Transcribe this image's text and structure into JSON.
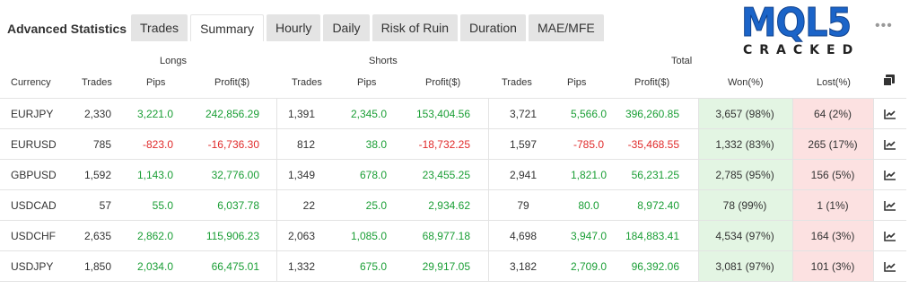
{
  "app": {
    "title": "Advanced Statistics"
  },
  "tabs": [
    {
      "label": "Trades",
      "active": false
    },
    {
      "label": "Summary",
      "active": true
    },
    {
      "label": "Hourly",
      "active": false
    },
    {
      "label": "Daily",
      "active": false
    },
    {
      "label": "Risk of Ruin",
      "active": false
    },
    {
      "label": "Duration",
      "active": false
    },
    {
      "label": "MAE/MFE",
      "active": false
    }
  ],
  "logo": {
    "main": "MQL5",
    "sub": "CRACKED"
  },
  "more_icon": "more-horizontal-icon",
  "groups": {
    "longs": "Longs",
    "shorts": "Shorts",
    "total": "Total"
  },
  "columns": {
    "currency": "Currency",
    "long_trades": "Trades",
    "long_pips": "Pips",
    "long_profit": "Profit($)",
    "short_trades": "Trades",
    "short_pips": "Pips",
    "short_profit": "Profit($)",
    "total_trades": "Trades",
    "total_pips": "Pips",
    "total_profit": "Profit($)",
    "won": "Won(%)",
    "lost": "Lost(%)"
  },
  "colors": {
    "positive": "#1a9e35",
    "negative": "#e02b2b",
    "won_bg": "#e3f5e3",
    "lost_bg": "#fce1e1"
  },
  "rows": [
    {
      "currency": "EURJPY",
      "long_trades": "2,330",
      "long_pips": "3,221.0",
      "long_profit": "242,856.29",
      "short_trades": "1,391",
      "short_pips": "2,345.0",
      "short_profit": "153,404.56",
      "total_trades": "3,721",
      "total_pips": "5,566.0",
      "total_profit": "396,260.85",
      "won": "3,657 (98%)",
      "lost": "64 (2%)"
    },
    {
      "currency": "EURUSD",
      "long_trades": "785",
      "long_pips": "-823.0",
      "long_profit": "-16,736.30",
      "short_trades": "812",
      "short_pips": "38.0",
      "short_profit": "-18,732.25",
      "total_trades": "1,597",
      "total_pips": "-785.0",
      "total_profit": "-35,468.55",
      "won": "1,332 (83%)",
      "lost": "265 (17%)"
    },
    {
      "currency": "GBPUSD",
      "long_trades": "1,592",
      "long_pips": "1,143.0",
      "long_profit": "32,776.00",
      "short_trades": "1,349",
      "short_pips": "678.0",
      "short_profit": "23,455.25",
      "total_trades": "2,941",
      "total_pips": "1,821.0",
      "total_profit": "56,231.25",
      "won": "2,785 (95%)",
      "lost": "156 (5%)"
    },
    {
      "currency": "USDCAD",
      "long_trades": "57",
      "long_pips": "55.0",
      "long_profit": "6,037.78",
      "short_trades": "22",
      "short_pips": "25.0",
      "short_profit": "2,934.62",
      "total_trades": "79",
      "total_pips": "80.0",
      "total_profit": "8,972.40",
      "won": "78 (99%)",
      "lost": "1 (1%)"
    },
    {
      "currency": "USDCHF",
      "long_trades": "2,635",
      "long_pips": "2,862.0",
      "long_profit": "115,906.23",
      "short_trades": "2,063",
      "short_pips": "1,085.0",
      "short_profit": "68,977.18",
      "total_trades": "4,698",
      "total_pips": "3,947.0",
      "total_profit": "184,883.41",
      "won": "4,534 (97%)",
      "lost": "164 (3%)"
    },
    {
      "currency": "USDJPY",
      "long_trades": "1,850",
      "long_pips": "2,034.0",
      "long_profit": "66,475.01",
      "short_trades": "1,332",
      "short_pips": "675.0",
      "short_profit": "29,917.05",
      "total_trades": "3,182",
      "total_pips": "2,709.0",
      "total_profit": "96,392.06",
      "won": "3,081 (97%)",
      "lost": "101 (3%)"
    }
  ]
}
